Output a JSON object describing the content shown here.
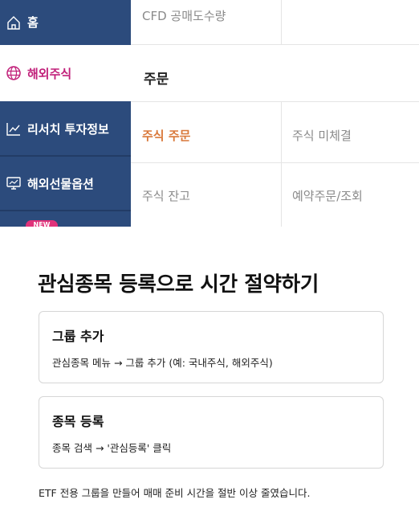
{
  "sidebar": {
    "items": [
      {
        "label": "홈",
        "icon": "home-icon"
      },
      {
        "label": "해외주식",
        "icon": "globe-icon"
      },
      {
        "label": "리서치 투자정보",
        "icon": "chart-line-icon"
      },
      {
        "label": "해외선물옵션",
        "icon": "monitor-chart-icon"
      }
    ],
    "new_badge": "NEW"
  },
  "menu": {
    "top_item": "CFD 공매도수량",
    "section_title": "주문",
    "grid": [
      [
        "주식 주문",
        "주식 미체결"
      ],
      [
        "주식 잔고",
        "예약주문/조회"
      ]
    ]
  },
  "colors": {
    "sidebar_bg": "#2c4b7c",
    "active_text": "#c1207a",
    "highlight_orange": "#d9783a"
  },
  "article": {
    "title": "관심종목 등록으로 시간 절약하기",
    "cards": [
      {
        "title": "그룹 추가",
        "desc": "관심종목 메뉴 → 그룹 추가 (예: 국내주식, 해외주식)"
      },
      {
        "title": "종목 등록",
        "desc": "종목 검색 → '관심등록' 클릭"
      }
    ],
    "note": "ETF 전용 그룹을 만들어 매매 준비 시간을 절반 이상 줄였습니다."
  }
}
